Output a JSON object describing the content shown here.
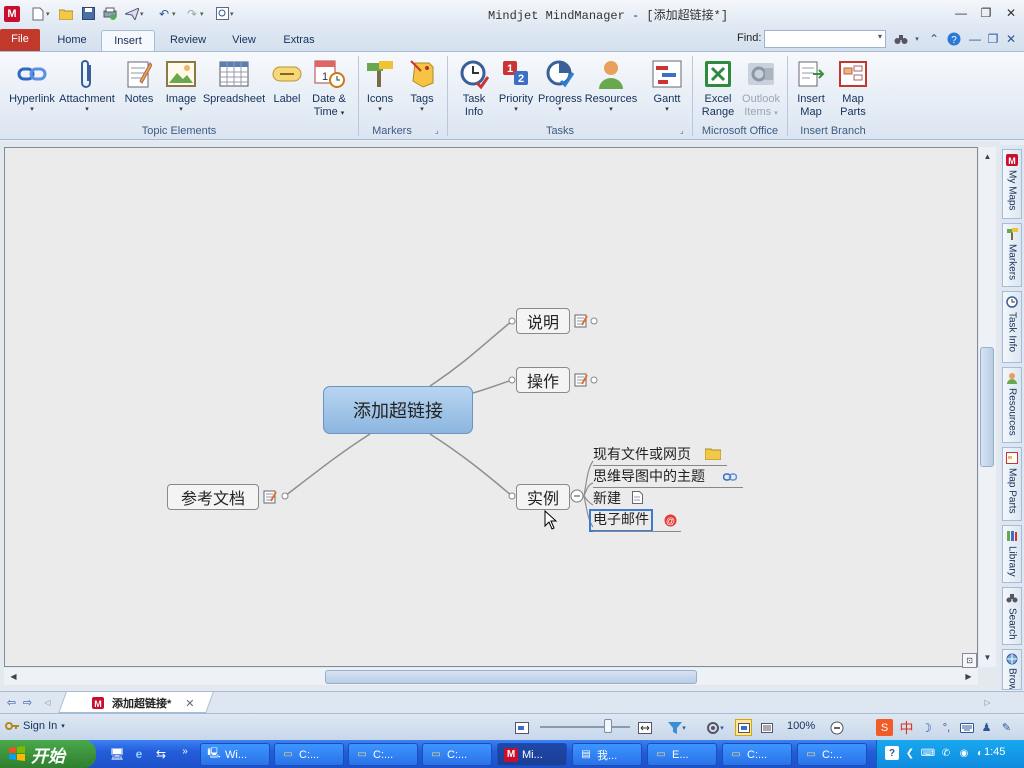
{
  "window": {
    "title": "Mindjet MindManager - [添加超链接*]"
  },
  "ribbon_tabs": [
    {
      "label": "File"
    },
    {
      "label": "Home"
    },
    {
      "label": "Insert"
    },
    {
      "label": "Review"
    },
    {
      "label": "View"
    },
    {
      "label": "Extras"
    }
  ],
  "active_tab": "Insert",
  "find": {
    "label": "Find:",
    "value": ""
  },
  "ribbon": {
    "topic_elements": {
      "label": "Topic Elements",
      "buttons": [
        "Hyperlink",
        "Attachment",
        "Notes",
        "Image",
        "Spreadsheet",
        "Label",
        "Date &",
        "Time"
      ]
    },
    "markers": {
      "label": "Markers",
      "buttons": [
        "Icons",
        "Tags"
      ]
    },
    "tasks": {
      "label": "Tasks",
      "buttons": [
        "Task",
        "Info",
        "Priority",
        "Progress",
        "Resources",
        "Gantt"
      ]
    },
    "microsoft_office": {
      "label": "Microsoft Office",
      "buttons": [
        "Excel",
        "Range",
        "Outlook",
        "Items"
      ]
    },
    "insert_branch": {
      "label": "Insert Branch",
      "buttons": [
        "Insert",
        "Map",
        "Map",
        "Parts"
      ]
    }
  },
  "side_panel": [
    "My Maps",
    "Markers",
    "Task Info",
    "Resources",
    "Map Parts",
    "Library",
    "Search",
    "Browser"
  ],
  "map": {
    "central": "添加超链接",
    "topics": {
      "shuoming": "说明",
      "caozuo": "操作",
      "shili": "实例",
      "cankao": "参考文档"
    },
    "subtopics": [
      "现有文件或网页",
      "思维导图中的主题",
      "新建",
      "电子邮件"
    ]
  },
  "document_tab": "添加超链接*",
  "status": {
    "sign_in": "Sign In",
    "zoom": "100%"
  },
  "taskbar": {
    "start": "开始",
    "buttons": [
      "Wi...",
      "C:...",
      "C:...",
      "C:...",
      "Mi...",
      "我...",
      "E...",
      "C:...",
      "C:..."
    ],
    "clock": "1:45"
  },
  "colors": {
    "central_fill": "#9cc2e8",
    "accent": "#c0392b",
    "taskbar": "#245edb",
    "start": "#3a8f3a"
  }
}
